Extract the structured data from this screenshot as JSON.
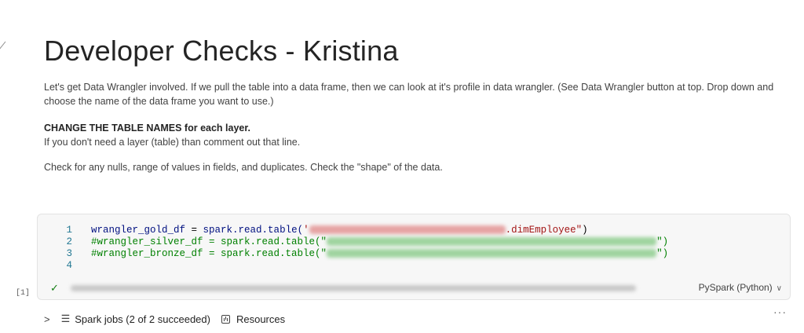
{
  "markdown": {
    "title": "Developer Checks - Kristina",
    "paragraph1": "Let's get Data Wrangler involved. If we pull the table into a data frame, then we can look at it's profile in data wrangler. (See Data Wrangler button at top. Drop down and choose the name of the data frame you want to use.)",
    "bold_heading": "CHANGE THE TABLE NAMES for each layer.",
    "paragraph2": "If you don't need a layer (table) than comment out that line.",
    "paragraph3": "Check for any nulls, range of values in fields, and duplicates. Check the \"shape\" of the data."
  },
  "code_cell": {
    "execution_count": "[1]",
    "language": "PySpark (Python)",
    "lines": [
      {
        "num": "1",
        "var": "wrangler_gold_df",
        "op": " = ",
        "call": "spark.read.table(",
        "str_open": "'",
        "str_end": ".dimEmployee\"",
        "close": ")"
      },
      {
        "num": "2",
        "comment_start": "#wrangler_silver_df = spark.read.table(\"",
        "comment_end": "\")"
      },
      {
        "num": "3",
        "comment_start": "#wrangler_bronze_df = spark.read.table(\"",
        "comment_end": "\")"
      },
      {
        "num": "4"
      }
    ]
  },
  "output": {
    "spark_jobs_label": "Spark jobs (2 of 2 succeeded)",
    "resources_label": "Resources"
  }
}
